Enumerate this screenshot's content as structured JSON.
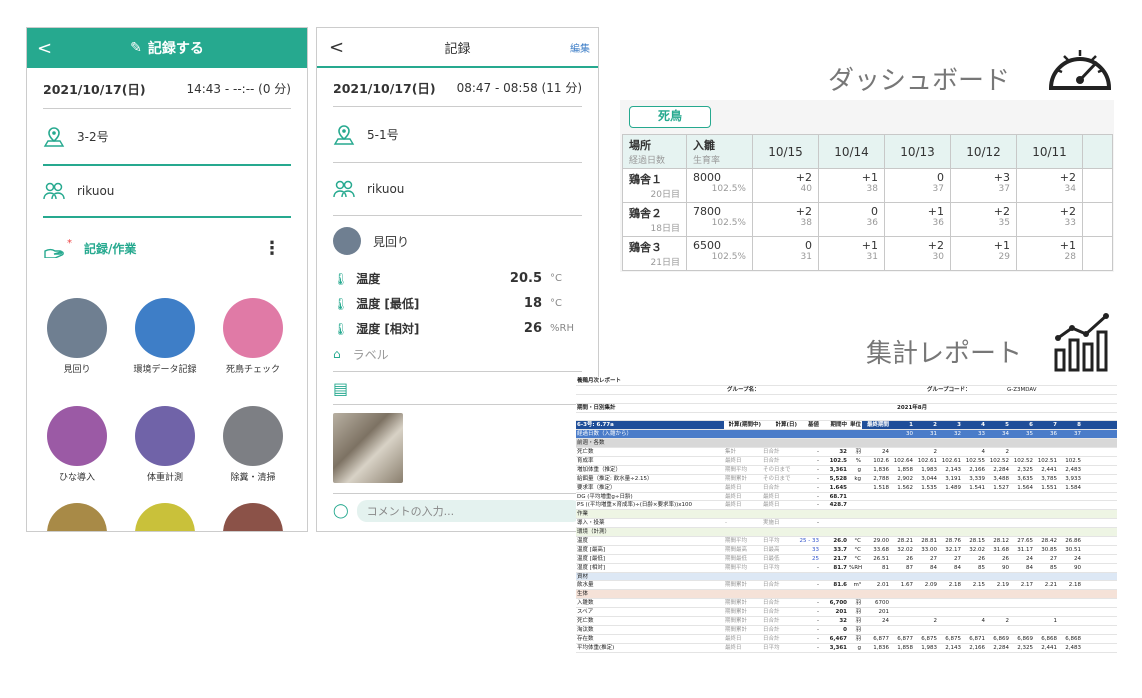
{
  "phone1": {
    "header_title": "記録する",
    "date": "2021/10/17(日)",
    "time": "14:43 - --:-- (0 分)",
    "place": "3-2号",
    "user": "rikuou",
    "section": "記録/作業",
    "icons": [
      {
        "label": "見回り",
        "color": "#6f7f91"
      },
      {
        "label": "環境データ記録",
        "color": "#3e7ec7"
      },
      {
        "label": "死鳥チェック",
        "color": "#e07aa6"
      },
      {
        "label": "ひな導入",
        "color": "#9b5aa5"
      },
      {
        "label": "体重計測",
        "color": "#7063a8"
      },
      {
        "label": "除糞・清掃",
        "color": "#7d7f84"
      },
      {
        "label": "",
        "color": "#a88a47"
      },
      {
        "label": "",
        "color": "#c9c13a"
      },
      {
        "label": "",
        "color": "#8b5248"
      }
    ]
  },
  "phone2": {
    "header_title": "記録",
    "edit": "編集",
    "date": "2021/10/17(日)",
    "time": "08:47 - 08:58 (11 分)",
    "place": "5-1号",
    "user": "rikuou",
    "activity": "見回り",
    "measures": [
      {
        "label": "温度",
        "value": "20.5",
        "unit": "°C"
      },
      {
        "label": "温度 [最低]",
        "value": "18",
        "unit": "°C"
      },
      {
        "label": "湿度 [相対]",
        "value": "26",
        "unit": "%RH"
      }
    ],
    "tag_placeholder": "ラベル",
    "comment_placeholder": "コメントの入力..."
  },
  "dashboard": {
    "title": "ダッシュボード",
    "tab": "死鳥",
    "col_place": "場所",
    "col_place_sub": "経過日数",
    "col_in": "入雛",
    "col_in_sub": "生育率",
    "dates": [
      "10/15",
      "10/14",
      "10/13",
      "10/12",
      "10/11"
    ],
    "rows": [
      {
        "name": "鶏舎１",
        "days": "20日目",
        "count": "8000",
        "rate": "102.5%",
        "vals": [
          [
            "+2",
            "40"
          ],
          [
            "+1",
            "38"
          ],
          [
            "0",
            "37"
          ],
          [
            "+3",
            "37"
          ],
          [
            "+2",
            "34"
          ]
        ]
      },
      {
        "name": "鶏舎２",
        "days": "18日目",
        "count": "7800",
        "rate": "102.5%",
        "vals": [
          [
            "+2",
            "38"
          ],
          [
            "0",
            "36"
          ],
          [
            "+1",
            "36"
          ],
          [
            "+2",
            "35"
          ],
          [
            "+2",
            "33"
          ]
        ]
      },
      {
        "name": "鶏舎３",
        "days": "21日目",
        "count": "6500",
        "rate": "102.5%",
        "vals": [
          [
            "0",
            "31"
          ],
          [
            "+1",
            "31"
          ],
          [
            "+2",
            "30"
          ],
          [
            "+1",
            "29"
          ],
          [
            "+1",
            "28"
          ]
        ]
      }
    ]
  },
  "report": {
    "title": "集計レポート",
    "sheet_title": "養鶏月次レポート",
    "group_label": "グループ名：",
    "code_label": "グループコード：",
    "code": "G-Z3MDAV",
    "period": "期間・日別集計",
    "month": "2021年8月",
    "house": "6-3号: 6.77a",
    "headers": [
      "計算(期間中)",
      "計算(日)",
      "基値",
      "期間中",
      "単位",
      "最終期間",
      "1",
      "2",
      "3",
      "4",
      "5",
      "6",
      "7",
      "8"
    ],
    "elapsed": [
      "経過日数（入雛から）",
      "30",
      "31",
      "32",
      "33",
      "34",
      "35",
      "36",
      "37"
    ],
    "rows": [
      [
        "前週・各数",
        "",
        "",
        "",
        "",
        "",
        "",
        "",
        "",
        "",
        "",
        "",
        "",
        "",
        ""
      ],
      [
        "死亡数",
        "集計",
        "日合計",
        "-",
        "32",
        "羽",
        "24",
        "",
        "2",
        "",
        "4",
        "2",
        "",
        "",
        ""
      ],
      [
        "育成率",
        "最終日",
        "日合計",
        "-",
        "102.5",
        "%",
        "102.6",
        "102.64",
        "102.61",
        "102.61",
        "102.55",
        "102.52",
        "102.52",
        "102.51",
        "102.5"
      ],
      [
        "増加体重（推定）",
        "期間平均",
        "その日まで",
        "-",
        "3,361",
        "g",
        "1,836",
        "1,858",
        "1,983",
        "2,143",
        "2,166",
        "2,284",
        "2,325",
        "2,441",
        "2,483"
      ],
      [
        "給餌量（推定: 飲水量÷2.15）",
        "期間累計",
        "その日まで",
        "-",
        "5,528",
        "kg",
        "2,788",
        "2,902",
        "3,044",
        "3,191",
        "3,339",
        "3,488",
        "3,635",
        "3,785",
        "3,933"
      ],
      [
        "要求率（推定）",
        "最終日",
        "日合計",
        "-",
        "1.645",
        "",
        "1.518",
        "1.562",
        "1.535",
        "1.489",
        "1.541",
        "1.527",
        "1.564",
        "1.551",
        "1.584"
      ],
      [
        "DG (平均増重g÷日齢)",
        "最終日",
        "最終日",
        "-",
        "68.71",
        "",
        "",
        "",
        "",
        "",
        "",
        "",
        "",
        "",
        ""
      ],
      [
        "PS ((平均増重×育成率)÷(日齢×要求率))x100",
        "最終日",
        "最終日",
        "-",
        "428.7",
        "",
        "",
        "",
        "",
        "",
        "",
        "",
        "",
        "",
        ""
      ],
      [
        "作業",
        "",
        "",
        "",
        "",
        "",
        "",
        "",
        "",
        "",
        "",
        "",
        "",
        "",
        ""
      ],
      [
        "導入・投薬",
        "-",
        "実施日",
        "-",
        "",
        "",
        "",
        "",
        "",
        "",
        "",
        "",
        "",
        "",
        ""
      ],
      [
        "環境（計測）",
        "",
        "",
        "",
        "",
        "",
        "",
        "",
        "",
        "",
        "",
        "",
        "",
        "",
        ""
      ],
      [
        "温度",
        "期間平均",
        "日平均",
        "25 - 33",
        "26.0",
        "°C",
        "29.00",
        "28.21",
        "28.81",
        "28.76",
        "28.15",
        "28.12",
        "27.65",
        "28.42",
        "26.86"
      ],
      [
        "温度 [最高]",
        "期間最高",
        "日最高",
        "33",
        "33.7",
        "°C",
        "33.68",
        "32.02",
        "33.00",
        "32.17",
        "32.02",
        "31.68",
        "31.17",
        "30.85",
        "30.51"
      ],
      [
        "温度 [最低]",
        "期間最低",
        "日最低",
        "25",
        "21.7",
        "°C",
        "26.51",
        "26",
        "27",
        "27",
        "26",
        "26",
        "24",
        "27",
        "24"
      ],
      [
        "湿度 [相対]",
        "期間平均",
        "日平均",
        "-",
        "81.7",
        "%RH",
        "81",
        "87",
        "84",
        "84",
        "85",
        "90",
        "84",
        "85",
        "90"
      ],
      [
        "資材",
        "",
        "",
        "",
        "",
        "",
        "",
        "",
        "",
        "",
        "",
        "",
        "",
        "",
        ""
      ],
      [
        "飲水量",
        "期間累計",
        "日合計",
        "-",
        "81.6",
        "m³",
        "2.01",
        "1.67",
        "2.09",
        "2.18",
        "2.15",
        "2.19",
        "2.17",
        "2.21",
        "2.18"
      ],
      [
        "生体",
        "",
        "",
        "",
        "",
        "",
        "",
        "",
        "",
        "",
        "",
        "",
        "",
        "",
        ""
      ],
      [
        "入雛数",
        "期間累計",
        "日合計",
        "-",
        "6,700",
        "羽",
        "6700",
        "",
        "",
        "",
        "",
        "",
        "",
        "",
        ""
      ],
      [
        "スペア",
        "期間累計",
        "日合計",
        "-",
        "201",
        "羽",
        "201",
        "",
        "",
        "",
        "",
        "",
        "",
        "",
        ""
      ],
      [
        "死亡数",
        "期間累計",
        "日合計",
        "-",
        "32",
        "羽",
        "24",
        "",
        "2",
        "",
        "4",
        "2",
        "",
        "1",
        ""
      ],
      [
        "淘汰数",
        "期間累計",
        "日合計",
        "-",
        "0",
        "羽",
        "",
        "",
        "",
        "",
        "",
        "",
        "",
        "",
        ""
      ],
      [
        "存在数",
        "最終日",
        "日合計",
        "-",
        "6,467",
        "羽",
        "6,877",
        "6,877",
        "6,875",
        "6,875",
        "6,871",
        "6,869",
        "6,869",
        "6,868",
        "6,868"
      ],
      [
        "平均体重(推定)",
        "最終日",
        "日平均",
        "-",
        "3,361",
        "g",
        "1,836",
        "1,858",
        "1,983",
        "2,143",
        "2,166",
        "2,284",
        "2,325",
        "2,441",
        "2,483"
      ]
    ]
  }
}
